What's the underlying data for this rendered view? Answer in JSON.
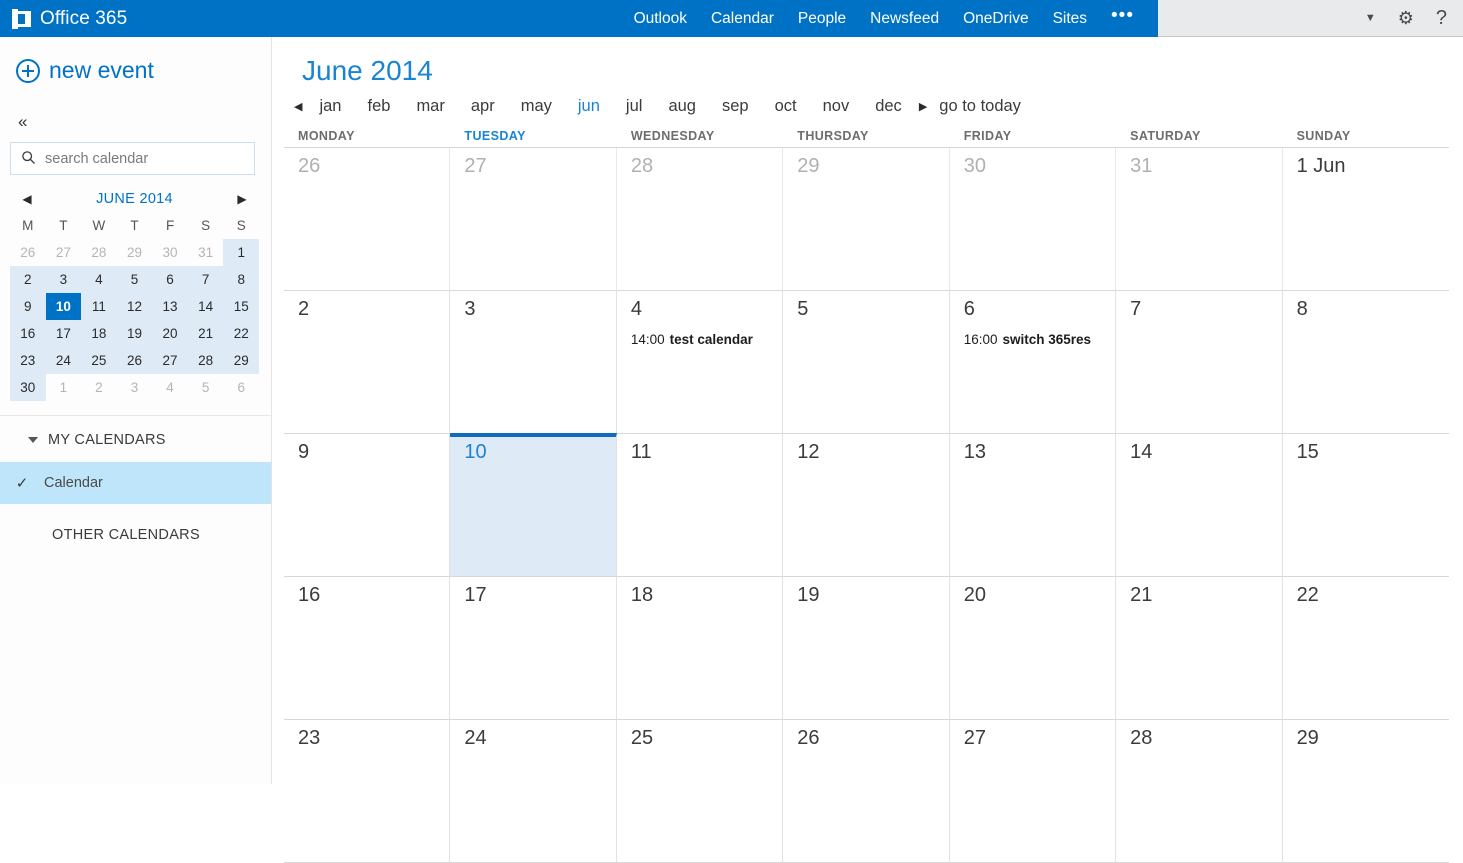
{
  "suite": {
    "brand": "Office 365",
    "logo_icon": "office-logo-icon",
    "nav": [
      {
        "label": "Outlook",
        "active": false
      },
      {
        "label": "Calendar",
        "active": true
      },
      {
        "label": "People",
        "active": false
      },
      {
        "label": "Newsfeed",
        "active": false
      },
      {
        "label": "OneDrive",
        "active": false
      },
      {
        "label": "Sites",
        "active": false
      }
    ],
    "overflow_label": "•••",
    "right_icons": {
      "account_chevron": "▼",
      "settings": "⚙",
      "help": "?"
    }
  },
  "sidebar": {
    "new_event_label": "new event",
    "new_event_icon": "plus-circle-icon",
    "collapse_icon": "«",
    "search": {
      "icon": "search-icon",
      "placeholder": "search calendar",
      "value": ""
    },
    "mini_calendar": {
      "title": "JUNE 2014",
      "prev_icon": "◀",
      "next_icon": "▶",
      "dow": [
        "M",
        "T",
        "W",
        "T",
        "F",
        "S",
        "S"
      ],
      "weeks": [
        [
          {
            "n": "26",
            "state": "other"
          },
          {
            "n": "27",
            "state": "other"
          },
          {
            "n": "28",
            "state": "other"
          },
          {
            "n": "29",
            "state": "other"
          },
          {
            "n": "30",
            "state": "other"
          },
          {
            "n": "31",
            "state": "other"
          },
          {
            "n": "1",
            "state": "in-month"
          }
        ],
        [
          {
            "n": "2",
            "state": "in-month"
          },
          {
            "n": "3",
            "state": "in-month"
          },
          {
            "n": "4",
            "state": "in-month"
          },
          {
            "n": "5",
            "state": "in-month"
          },
          {
            "n": "6",
            "state": "in-month"
          },
          {
            "n": "7",
            "state": "in-month"
          },
          {
            "n": "8",
            "state": "in-month"
          }
        ],
        [
          {
            "n": "9",
            "state": "in-month"
          },
          {
            "n": "10",
            "state": "today"
          },
          {
            "n": "11",
            "state": "in-month"
          },
          {
            "n": "12",
            "state": "in-month"
          },
          {
            "n": "13",
            "state": "in-month"
          },
          {
            "n": "14",
            "state": "in-month"
          },
          {
            "n": "15",
            "state": "in-month"
          }
        ],
        [
          {
            "n": "16",
            "state": "in-month"
          },
          {
            "n": "17",
            "state": "in-month"
          },
          {
            "n": "18",
            "state": "in-month"
          },
          {
            "n": "19",
            "state": "in-month"
          },
          {
            "n": "20",
            "state": "in-month"
          },
          {
            "n": "21",
            "state": "in-month"
          },
          {
            "n": "22",
            "state": "in-month"
          }
        ],
        [
          {
            "n": "23",
            "state": "in-month"
          },
          {
            "n": "24",
            "state": "in-month"
          },
          {
            "n": "25",
            "state": "in-month"
          },
          {
            "n": "26",
            "state": "in-month"
          },
          {
            "n": "27",
            "state": "in-month"
          },
          {
            "n": "28",
            "state": "in-month"
          },
          {
            "n": "29",
            "state": "in-month"
          }
        ],
        [
          {
            "n": "30",
            "state": "in-month"
          },
          {
            "n": "1",
            "state": "other"
          },
          {
            "n": "2",
            "state": "other"
          },
          {
            "n": "3",
            "state": "other"
          },
          {
            "n": "4",
            "state": "other"
          },
          {
            "n": "5",
            "state": "other"
          },
          {
            "n": "6",
            "state": "other"
          }
        ]
      ]
    },
    "my_calendars_label": "MY CALENDARS",
    "calendar_item_label": "Calendar",
    "calendar_item_check": "✓",
    "other_calendars_label": "OTHER CALENDARS"
  },
  "main": {
    "title": "June 2014",
    "prev_icon": "◀",
    "next_icon": "▶",
    "months": [
      {
        "label": "jan",
        "active": false
      },
      {
        "label": "feb",
        "active": false
      },
      {
        "label": "mar",
        "active": false
      },
      {
        "label": "apr",
        "active": false
      },
      {
        "label": "may",
        "active": false
      },
      {
        "label": "jun",
        "active": true
      },
      {
        "label": "jul",
        "active": false
      },
      {
        "label": "aug",
        "active": false
      },
      {
        "label": "sep",
        "active": false
      },
      {
        "label": "oct",
        "active": false
      },
      {
        "label": "nov",
        "active": false
      },
      {
        "label": "dec",
        "active": false
      }
    ],
    "go_to_today": "go to today",
    "dow_headers": [
      {
        "label": "MONDAY",
        "today": false
      },
      {
        "label": "TUESDAY",
        "today": true
      },
      {
        "label": "WEDNESDAY",
        "today": false
      },
      {
        "label": "THURSDAY",
        "today": false
      },
      {
        "label": "FRIDAY",
        "today": false
      },
      {
        "label": "SATURDAY",
        "today": false
      },
      {
        "label": "SUNDAY",
        "today": false
      }
    ],
    "days": [
      {
        "num": "26",
        "state": "other",
        "events": []
      },
      {
        "num": "27",
        "state": "other",
        "events": []
      },
      {
        "num": "28",
        "state": "other",
        "events": []
      },
      {
        "num": "29",
        "state": "other",
        "events": []
      },
      {
        "num": "30",
        "state": "other",
        "events": []
      },
      {
        "num": "31",
        "state": "other",
        "events": []
      },
      {
        "num": "1 Jun",
        "state": "current",
        "events": []
      },
      {
        "num": "2",
        "state": "current",
        "events": []
      },
      {
        "num": "3",
        "state": "current",
        "events": []
      },
      {
        "num": "4",
        "state": "current",
        "events": [
          {
            "time": "14:00",
            "title": "test calendar"
          }
        ]
      },
      {
        "num": "5",
        "state": "current",
        "events": []
      },
      {
        "num": "6",
        "state": "current",
        "events": [
          {
            "time": "16:00",
            "title": "switch 365res"
          }
        ]
      },
      {
        "num": "7",
        "state": "current",
        "events": []
      },
      {
        "num": "8",
        "state": "current",
        "events": []
      },
      {
        "num": "9",
        "state": "current",
        "events": []
      },
      {
        "num": "10",
        "state": "today",
        "events": []
      },
      {
        "num": "11",
        "state": "current",
        "events": []
      },
      {
        "num": "12",
        "state": "current",
        "events": []
      },
      {
        "num": "13",
        "state": "current",
        "events": []
      },
      {
        "num": "14",
        "state": "current",
        "events": []
      },
      {
        "num": "15",
        "state": "current",
        "events": []
      },
      {
        "num": "16",
        "state": "current",
        "events": []
      },
      {
        "num": "17",
        "state": "current",
        "events": []
      },
      {
        "num": "18",
        "state": "current",
        "events": []
      },
      {
        "num": "19",
        "state": "current",
        "events": []
      },
      {
        "num": "20",
        "state": "current",
        "events": []
      },
      {
        "num": "21",
        "state": "current",
        "events": []
      },
      {
        "num": "22",
        "state": "current",
        "events": []
      },
      {
        "num": "23",
        "state": "current",
        "events": []
      },
      {
        "num": "24",
        "state": "current",
        "events": []
      },
      {
        "num": "25",
        "state": "current",
        "events": []
      },
      {
        "num": "26",
        "state": "current",
        "events": []
      },
      {
        "num": "27",
        "state": "current",
        "events": []
      },
      {
        "num": "28",
        "state": "current",
        "events": []
      },
      {
        "num": "29",
        "state": "current",
        "events": []
      }
    ]
  },
  "colors": {
    "brand_blue": "#0072c6",
    "accent_blue": "#1a84d4",
    "today_bg": "#deeaf6",
    "selected_item_bg": "#bfe5fb"
  }
}
